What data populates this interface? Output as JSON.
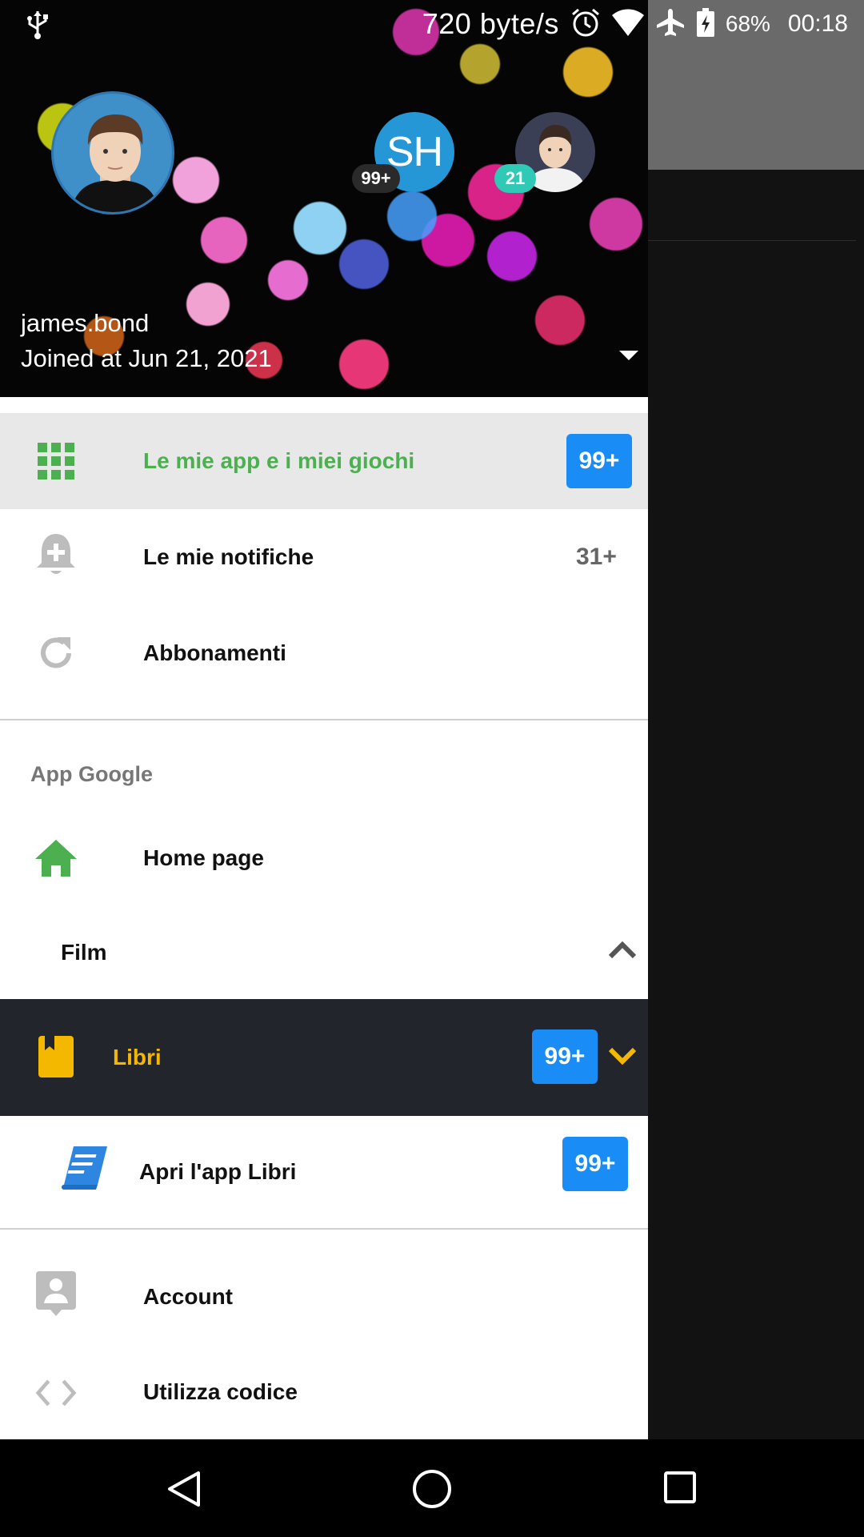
{
  "status_bar": {
    "net_speed": "720 byte/s",
    "battery": "68%",
    "time": "00:18"
  },
  "header": {
    "username": "james.bond",
    "joined": "Joined at Jun 21, 2021",
    "accounts": [
      {
        "initials": "",
        "badge": ""
      },
      {
        "initials": "SH",
        "badge": "99+"
      },
      {
        "initials": "",
        "badge": "21"
      }
    ]
  },
  "menu": {
    "items": [
      {
        "label": "Le mie app e i miei giochi",
        "badge": "99+"
      },
      {
        "label": "Le mie notifiche",
        "count": "31+"
      },
      {
        "label": "Abbonamenti"
      }
    ],
    "section_title": "App Google",
    "google_items": [
      {
        "label": "Home page"
      },
      {
        "label": "Film"
      },
      {
        "label": "Libri",
        "badge": "99+"
      },
      {
        "label": "Apri l'app Libri",
        "badge": "99+"
      }
    ],
    "bottom_items": [
      {
        "label": "Account"
      },
      {
        "label": "Utilizza codice"
      }
    ]
  },
  "colors": {
    "accent_green": "#4caf50",
    "selected_bg": "#e8e8e8",
    "libri_bg": "#22252b",
    "libri_accent": "#f5b800",
    "badge_blue": "#1a8cf5"
  },
  "icons": [
    "usb-icon",
    "alarm-icon",
    "wifi-icon",
    "airplane-icon",
    "battery-icon",
    "apps-grid-icon",
    "bell-plus-icon",
    "refresh-icon",
    "home-icon",
    "chevron-up-icon",
    "book-icon",
    "chevron-down-icon",
    "open-book-icon",
    "account-icon",
    "code-icon",
    "back-icon",
    "home-circle-icon",
    "recents-icon"
  ]
}
